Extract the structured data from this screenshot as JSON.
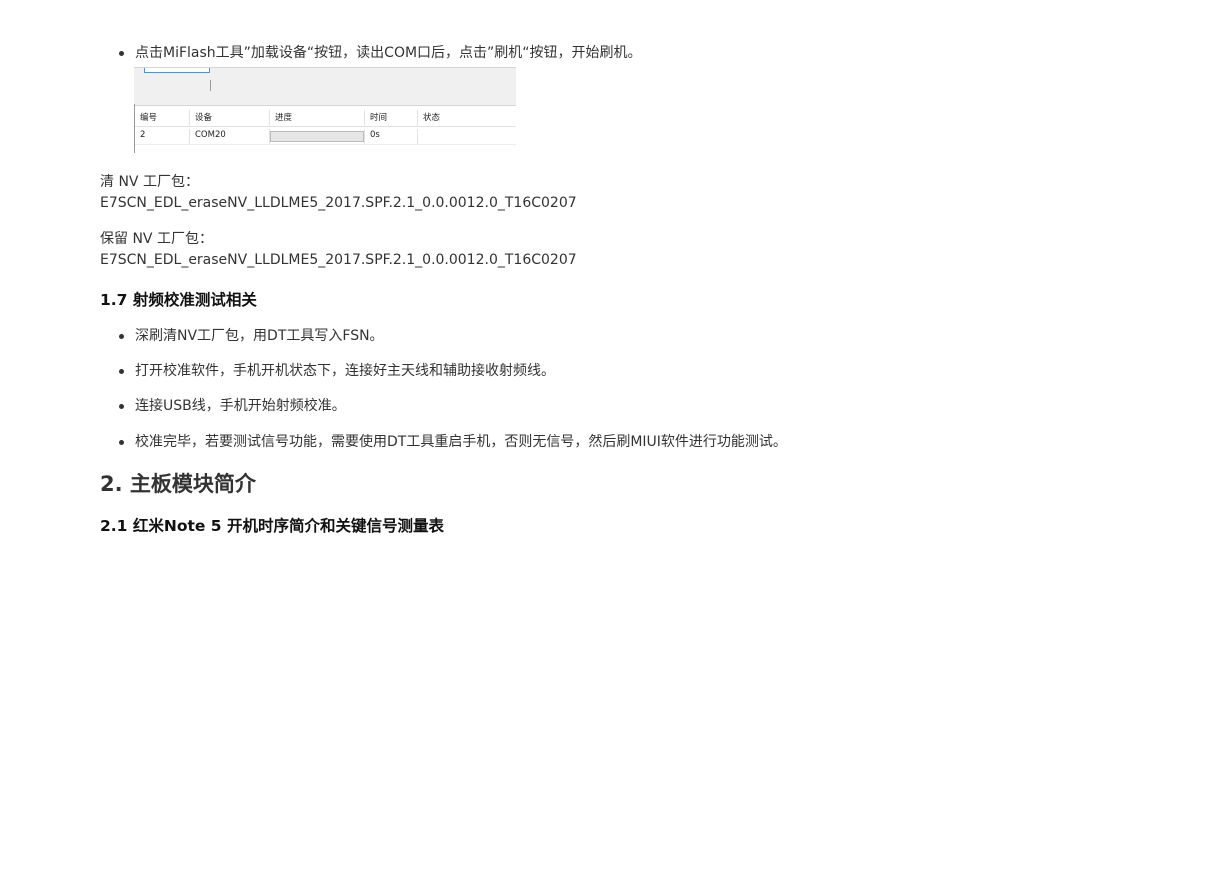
{
  "flash_step": "点击MiFlash工具”加载设备“按钮，读出COM口后，点击”刷机“按钮，开始刷机。",
  "miflash_table": {
    "columns": [
      "编号",
      "设备",
      "进度",
      "时间",
      "状态"
    ],
    "rows": [
      {
        "id": "2",
        "device": "COM20",
        "progress": 0,
        "time": "0s",
        "status": ""
      }
    ]
  },
  "clear_nv": {
    "label": "清 NV 工厂包：",
    "file": "E7SCN_EDL_eraseNV_LLDLME5_2017.SPF.2.1_0.0.0012.0_T16C0207"
  },
  "keep_nv": {
    "label": "保留 NV 工厂包：",
    "file": "E7SCN_EDL_eraseNV_LLDLME5_2017.SPF.2.1_0.0.0012.0_T16C0207"
  },
  "section_rf": {
    "heading": "1.7 射频校准测试相关",
    "items": [
      "深刷清NV工厂包，用DT工具写入FSN。",
      "打开校准软件，手机开机状态下，连接好主天线和辅助接收射频线。",
      "连接USB线，手机开始射频校准。",
      "校准完毕，若要测试信号功能，需要使用DT工具重启手机，否则无信号，然后刷MIUI软件进行功能测试。"
    ]
  },
  "section_2": {
    "heading": "2. 主板模块简介"
  },
  "section_2_1": {
    "heading": "2.1 红米Note 5 开机时序简介和关键信号测量表"
  }
}
